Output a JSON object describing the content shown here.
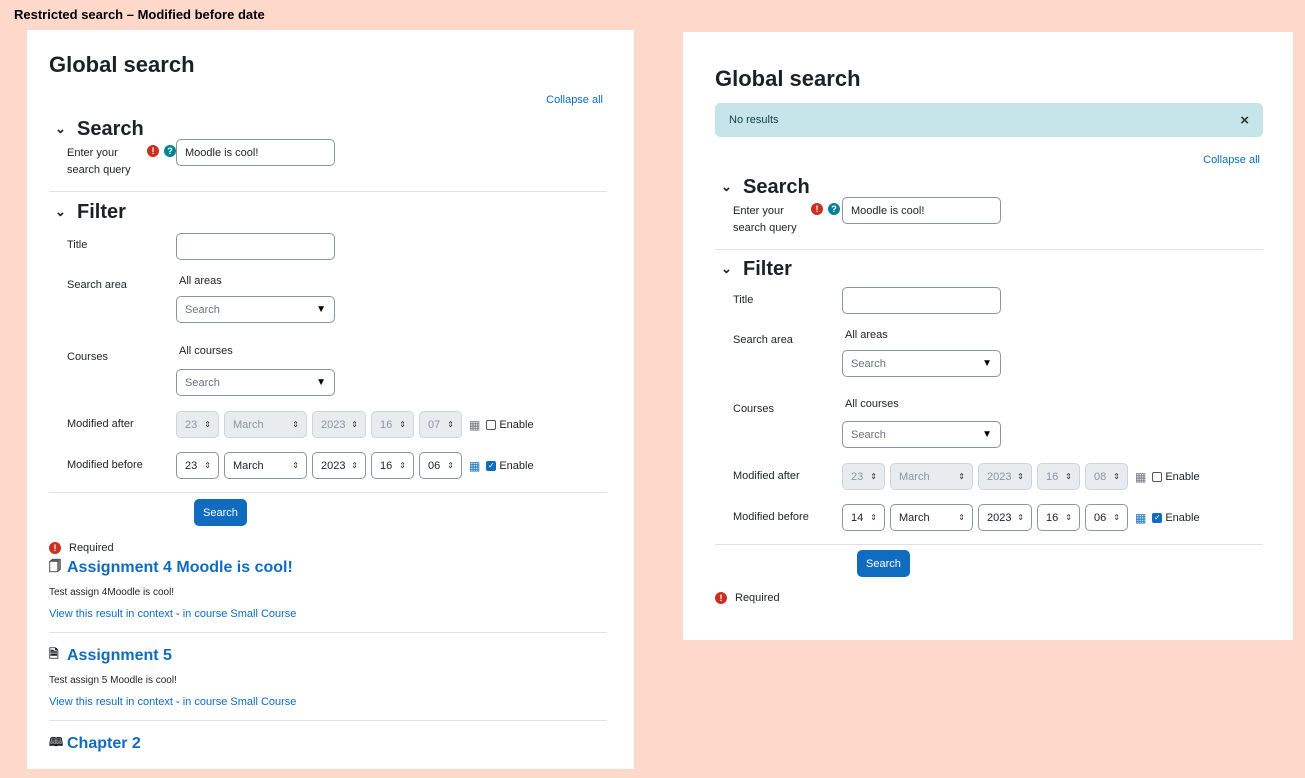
{
  "caption": "Restricted search – Modified before date",
  "left": {
    "title": "Global search",
    "collapse_all": "Collapse all",
    "search_section": "Search",
    "query_label_1": "Enter your",
    "query_label_2": "search query",
    "query_value": "Moodle is cool!",
    "filter_section": "Filter",
    "title_label": "Title",
    "title_value": "",
    "search_area_label": "Search area",
    "search_area_value": "All areas",
    "search_area_placeholder": "Search",
    "courses_label": "Courses",
    "courses_value": "All courses",
    "courses_placeholder": "Search",
    "modified_after_label": "Modified after",
    "modified_after": {
      "day": "23",
      "month": "March",
      "year": "2023",
      "hour": "16",
      "minute": "07",
      "enable_label": "Enable",
      "enabled": false
    },
    "modified_before_label": "Modified before",
    "modified_before": {
      "day": "23",
      "month": "March",
      "year": "2023",
      "hour": "16",
      "minute": "06",
      "enable_label": "Enable",
      "enabled": true
    },
    "search_button": "Search",
    "required_label": "Required",
    "results": [
      {
        "title": "Assignment 4 Moodle is cool!",
        "desc": "Test assign 4Moodle is cool!",
        "context_link": "View this result in context",
        "sep": " - ",
        "course_link": "in course Small Course",
        "icon": "file-icon"
      },
      {
        "title": "Assignment 5",
        "desc": "Test assign 5 Moodle is cool!",
        "context_link": "View this result in context",
        "sep": " - ",
        "course_link": "in course Small Course",
        "icon": "file-upload-icon"
      },
      {
        "title": "Chapter 2",
        "icon": "book-icon"
      }
    ]
  },
  "right": {
    "title": "Global search",
    "alert": "No results",
    "collapse_all": "Collapse all",
    "search_section": "Search",
    "query_label_1": "Enter your",
    "query_label_2": "search query",
    "query_value": "Moodle is cool!",
    "filter_section": "Filter",
    "title_label": "Title",
    "title_value": "",
    "search_area_label": "Search area",
    "search_area_value": "All areas",
    "search_area_placeholder": "Search",
    "courses_label": "Courses",
    "courses_value": "All courses",
    "courses_placeholder": "Search",
    "modified_after_label": "Modified after",
    "modified_after": {
      "day": "23",
      "month": "March",
      "year": "2023",
      "hour": "16",
      "minute": "08",
      "enable_label": "Enable",
      "enabled": false
    },
    "modified_before_label": "Modified before",
    "modified_before": {
      "day": "14",
      "month": "March",
      "year": "2023",
      "hour": "16",
      "minute": "06",
      "enable_label": "Enable",
      "enabled": true
    },
    "search_button": "Search",
    "required_label": "Required"
  },
  "colors": {
    "background": "#ffd8cc",
    "primary": "#0f6cbf",
    "required": "#ca3120",
    "help": "#008196",
    "alert_bg": "#c6e5ea"
  }
}
